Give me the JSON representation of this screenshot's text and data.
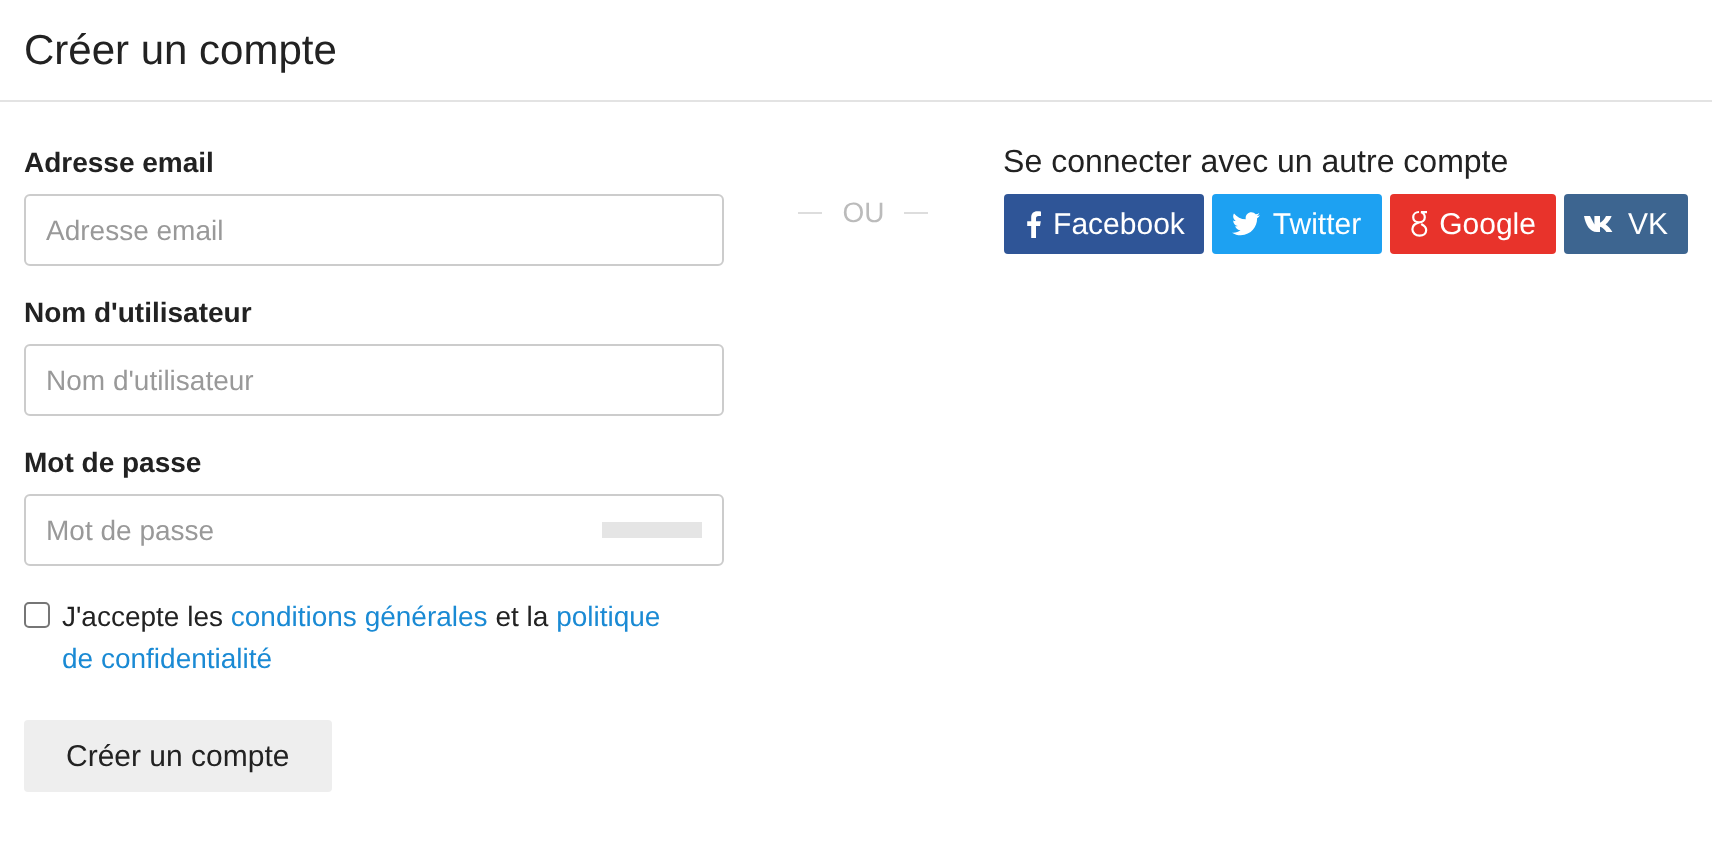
{
  "title": "Créer un compte",
  "fields": [
    {
      "label": "Adresse email",
      "placeholder": "Adresse email"
    },
    {
      "label": "Nom d'utilisateur",
      "placeholder": "Nom d'utilisateur"
    },
    {
      "label": "Mot de passe",
      "placeholder": "Mot de passe",
      "strength": {
        "level": 0
      }
    }
  ],
  "terms": {
    "checked": false,
    "parts": [
      {
        "kind": "text",
        "text": "J'accepte les "
      },
      {
        "kind": "link",
        "text": "conditions générales"
      },
      {
        "kind": "text",
        "text": " et la "
      },
      {
        "kind": "link",
        "text": "politique"
      },
      {
        "kind": "link",
        "text": "de confidentialité"
      }
    ]
  },
  "submit": "Créer un compte",
  "separator": "OU",
  "social": {
    "heading": "Se connecter avec un autre compte",
    "buttons": [
      {
        "kind": "facebook",
        "label": "Facebook",
        "color": "#2f5597"
      },
      {
        "kind": "twitter",
        "label": "Twitter",
        "color": "#1da1f2"
      },
      {
        "kind": "google",
        "label": "Google",
        "color": "#e8332b"
      },
      {
        "kind": "vk",
        "label": "VK",
        "color": "#3d6590"
      }
    ]
  }
}
